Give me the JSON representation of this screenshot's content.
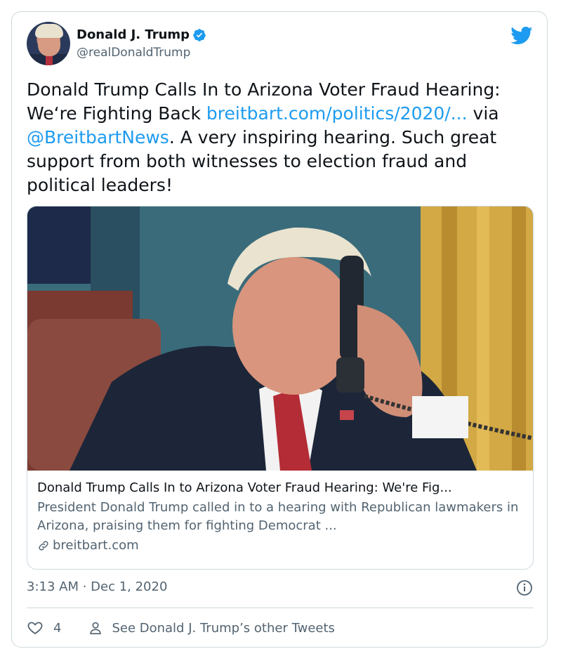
{
  "author": {
    "display_name": "Donald J. Trump",
    "handle": "@realDonaldTrump",
    "verified": true
  },
  "tweet": {
    "text_line1": "Donald Trump Calls In to Arizona Voter Fraud Hearing:",
    "text_line2_prefix": "We‘re Fighting Back ",
    "link_text": "breitbart.com/politics/2020/...",
    "text_via": " via",
    "mention": "@BreitbartNews",
    "text_rest": ". A very inspiring hearing. Such great support from both witnesses to election fraud and political leaders!"
  },
  "link_card": {
    "title": "Donald Trump Calls In to Arizona Voter Fraud Hearing: We're Fig...",
    "description": "President Donald Trump called in to a hearing with Republican lawmakers in Arizona, praising them for fighting Democrat ...",
    "domain": "breitbart.com"
  },
  "meta": {
    "timestamp": "3:13 AM · Dec 1, 2020"
  },
  "actions": {
    "like_count": "4",
    "other_tweets_label": "See Donald J. Trump’s other Tweets"
  },
  "icons": {
    "verified": "verified-badge-icon",
    "logo": "twitter-bird-icon",
    "info": "info-icon",
    "like": "heart-icon",
    "profile": "person-icon",
    "link": "link-icon"
  },
  "colors": {
    "link": "#1d9bf0",
    "secondary_text": "#536471",
    "border": "#cfd9de"
  }
}
